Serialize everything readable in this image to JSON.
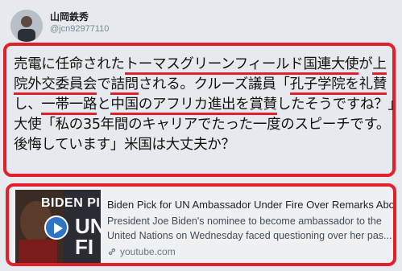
{
  "user": {
    "name": "山岡鉄秀",
    "handle": "@jcn92977110"
  },
  "tweet": {
    "seg1": "売電に任命された",
    "seg2": "トーマスグリーンフィールド国連大使",
    "seg3": "が",
    "seg4": "上院外交委員会",
    "seg5": "で",
    "seg6": "詰問",
    "seg7": "される。クルーズ議員「",
    "seg8": "孔子学院を礼賛",
    "seg9": "し、",
    "seg10": "一帯一路",
    "seg11": "と",
    "seg12": "中国のアフリカ進出を賞賛",
    "seg13": "したそうですね？」大使「私の35年間のキャリアでたった一度のスピーチです。後悔しています」米国は大丈夫か？"
  },
  "card": {
    "thumb_line1": "BIDEN PI",
    "thumb_line2": "UN",
    "thumb_line3": "FI",
    "title": "Biden Pick for UN Ambassador Under Fire Over Remarks Abo...",
    "description_line1": "President Joe Biden's nominee to become ambassador to the",
    "description_line2": "United Nations on Wednesday faced questioning over her pas...",
    "domain": "youtube.com"
  },
  "colors": {
    "highlight": "#e3202a",
    "play_button": "#2f74c5"
  },
  "icons": {
    "play": "play-icon",
    "link": "link-icon"
  }
}
